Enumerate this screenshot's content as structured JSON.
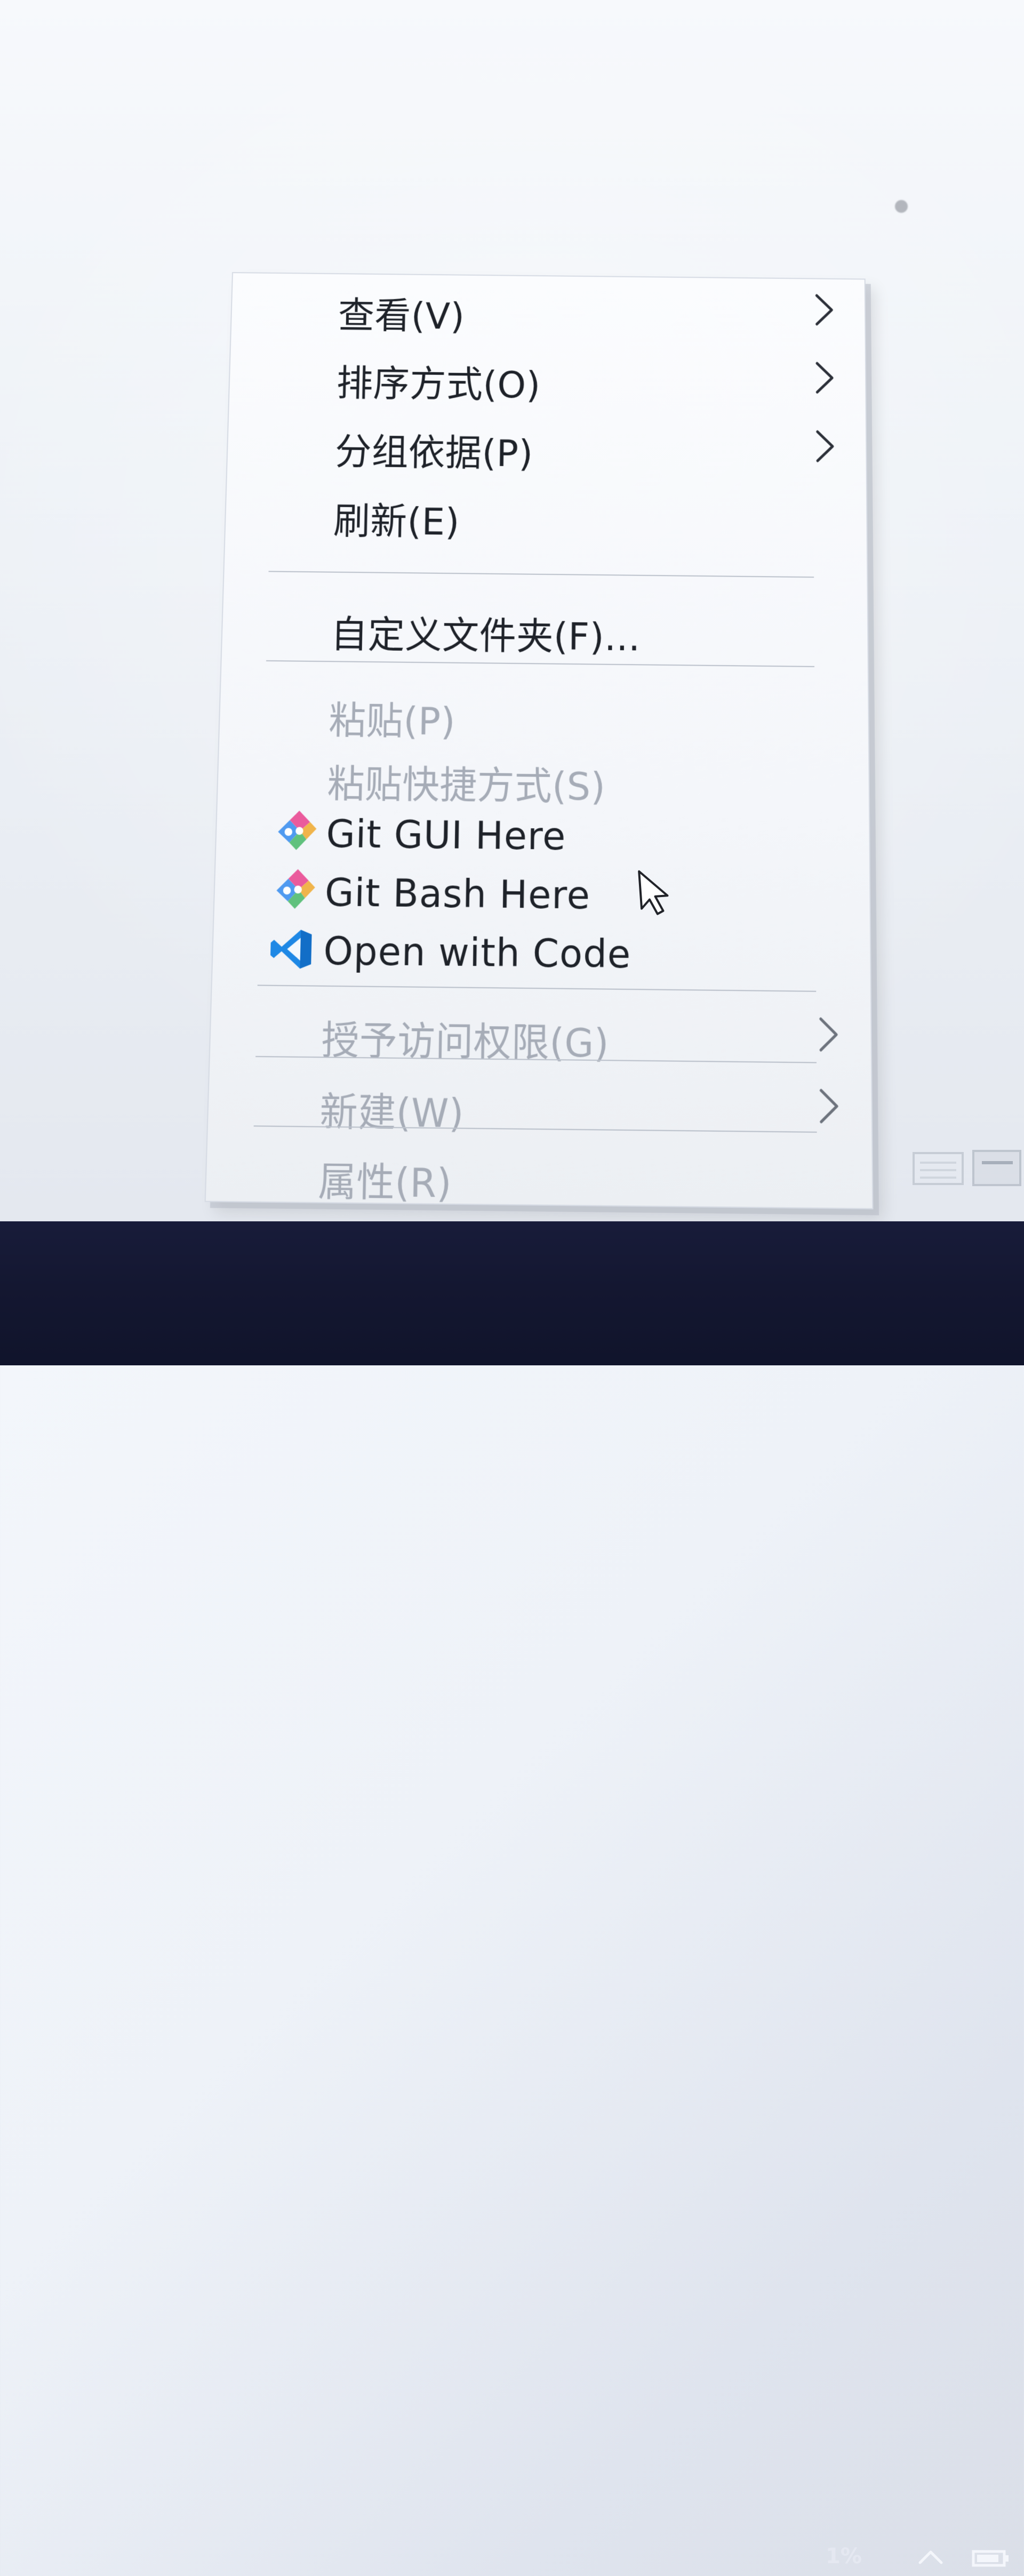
{
  "context_menu": {
    "items": [
      {
        "label": "查看(V)"
      },
      {
        "label": "排序方式(O)"
      },
      {
        "label": "分组依据(P)"
      },
      {
        "label": "刷新(E)"
      },
      {
        "label": "自定义文件夹(F)..."
      },
      {
        "label": "粘贴(P)"
      },
      {
        "label": "粘贴快捷方式(S)"
      },
      {
        "label": "Git GUI Here"
      },
      {
        "label": "Git Bash Here"
      },
      {
        "label": "Open with Code"
      },
      {
        "label": "授予访问权限(G)"
      },
      {
        "label": "新建(W)"
      },
      {
        "label": "属性(R)"
      }
    ]
  },
  "status": {
    "cpu_percent": "1%"
  },
  "colors": {
    "disabled": "#a6acb7",
    "text": "#1e2229",
    "vscode_blue": "#1e88e5"
  }
}
